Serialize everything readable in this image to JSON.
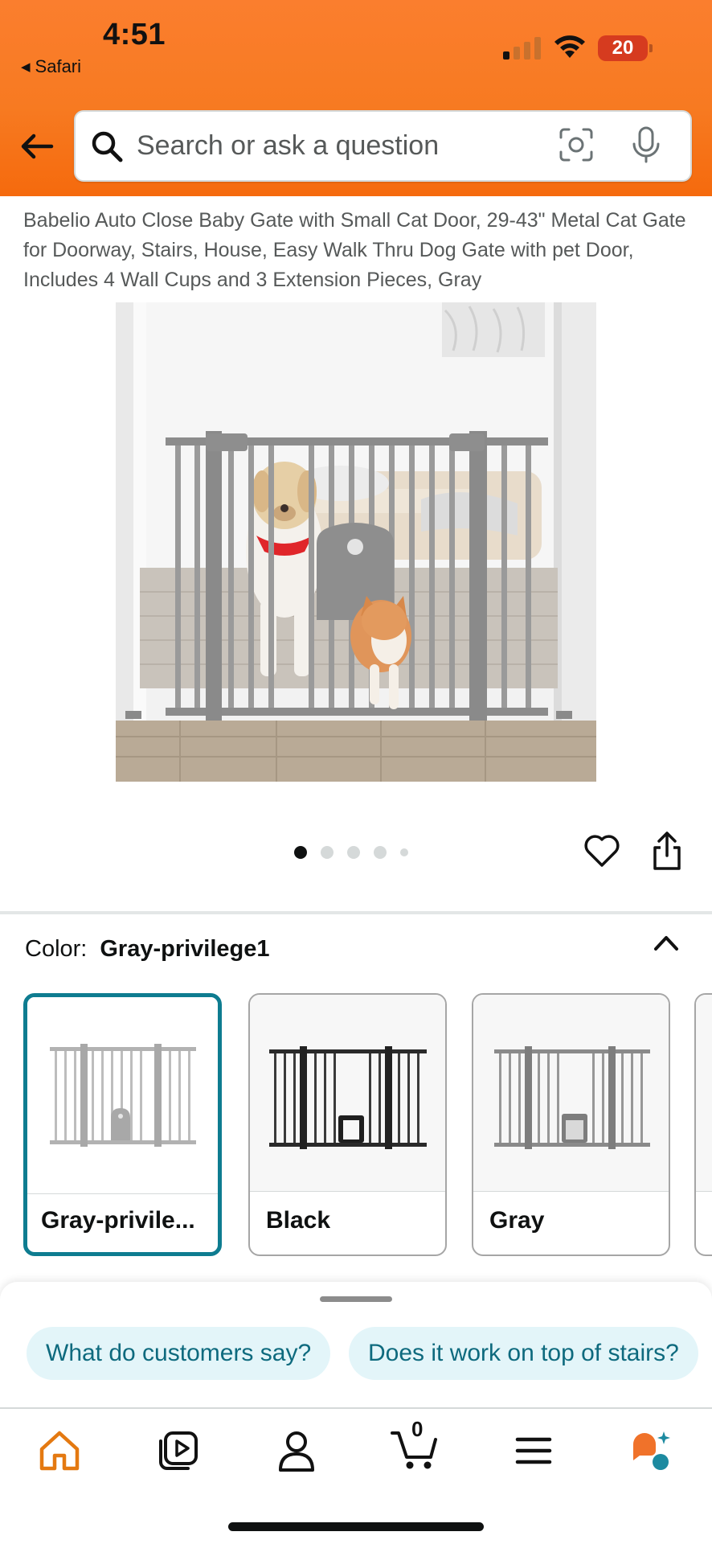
{
  "status_bar": {
    "time": "4:51",
    "back_app": "Safari",
    "battery": "20"
  },
  "search": {
    "placeholder": "Search or ask a question"
  },
  "product": {
    "title": "Babelio Auto Close Baby Gate with Small Cat Door, 29-43\" Metal Cat Gate for Doorway, Stairs, House, Easy Walk Thru Dog Gate with pet Door, Includes 4 Wall Cups and 3 Extension Pieces, Gray",
    "image_description_icon": "baby-gate-with-dog-and-cat",
    "gate_brand_text": "babelio",
    "image_count": 5,
    "current_image": 1
  },
  "variation": {
    "label": "Color:",
    "selected_value": "Gray-privilege1",
    "options": [
      {
        "label": "Gray-privile...",
        "selected": true
      },
      {
        "label": "Black",
        "selected": false
      },
      {
        "label": "Gray",
        "selected": false
      }
    ]
  },
  "suggestions": [
    "What do customers say?",
    "Does it work on top of stairs?"
  ],
  "nav": {
    "cart_count": "0",
    "items": [
      "home-icon",
      "video-icon",
      "account-icon",
      "cart-icon",
      "menu-icon",
      "rufus-icon"
    ]
  },
  "colors": {
    "header_orange": "#f77a21",
    "selected_border": "#0e7c90",
    "chip_bg": "#e3f5f9",
    "chip_text": "#0e6a7e",
    "home_active": "#e47911"
  }
}
